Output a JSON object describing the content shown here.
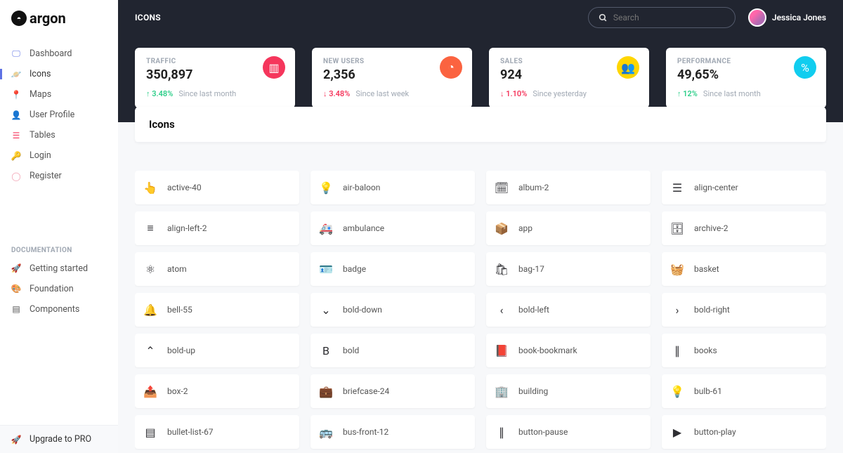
{
  "brand": "argon",
  "page_title": "ICONS",
  "search": {
    "placeholder": "Search"
  },
  "user": {
    "name": "Jessica Jones"
  },
  "sidebar": {
    "items": [
      {
        "label": "Dashboard",
        "icon": "tv",
        "color": "i-blue"
      },
      {
        "label": "Icons",
        "icon": "planet",
        "color": "i-orange",
        "active": true
      },
      {
        "label": "Maps",
        "icon": "pin",
        "color": "i-red"
      },
      {
        "label": "User Profile",
        "icon": "user",
        "color": "i-yellow"
      },
      {
        "label": "Tables",
        "icon": "list",
        "color": "i-red"
      },
      {
        "label": "Login",
        "icon": "key",
        "color": "i-cyan"
      },
      {
        "label": "Register",
        "icon": "circle",
        "color": "i-pink"
      }
    ],
    "doc_header": "DOCUMENTATION",
    "docs": [
      {
        "label": "Getting started",
        "icon": "rocket"
      },
      {
        "label": "Foundation",
        "icon": "palette"
      },
      {
        "label": "Components",
        "icon": "ui"
      }
    ],
    "upgrade": "Upgrade to PRO"
  },
  "stats": [
    {
      "label": "TRAFFIC",
      "value": "350,897",
      "delta": "3.48%",
      "dir": "up",
      "since": "Since last month",
      "color": "c-red",
      "icon": "chart-bar"
    },
    {
      "label": "NEW USERS",
      "value": "2,356",
      "delta": "3.48%",
      "dir": "down",
      "since": "Since last week",
      "color": "c-orange",
      "icon": "pie"
    },
    {
      "label": "SALES",
      "value": "924",
      "delta": "1.10%",
      "dir": "down",
      "since": "Since yesterday",
      "color": "c-yellow",
      "icon": "users"
    },
    {
      "label": "PERFORMANCE",
      "value": "49,65%",
      "delta": "12%",
      "dir": "up",
      "since": "Since last month",
      "color": "c-cyan",
      "icon": "percent"
    }
  ],
  "panel": {
    "title": "Icons"
  },
  "icons": [
    "active-40",
    "air-baloon",
    "album-2",
    "align-center",
    "align-left-2",
    "ambulance",
    "app",
    "archive-2",
    "atom",
    "badge",
    "bag-17",
    "basket",
    "bell-55",
    "bold-down",
    "bold-left",
    "bold-right",
    "bold-up",
    "bold",
    "book-bookmark",
    "books",
    "box-2",
    "briefcase-24",
    "building",
    "bulb-61",
    "bullet-list-67",
    "bus-front-12",
    "button-pause",
    "button-play"
  ]
}
